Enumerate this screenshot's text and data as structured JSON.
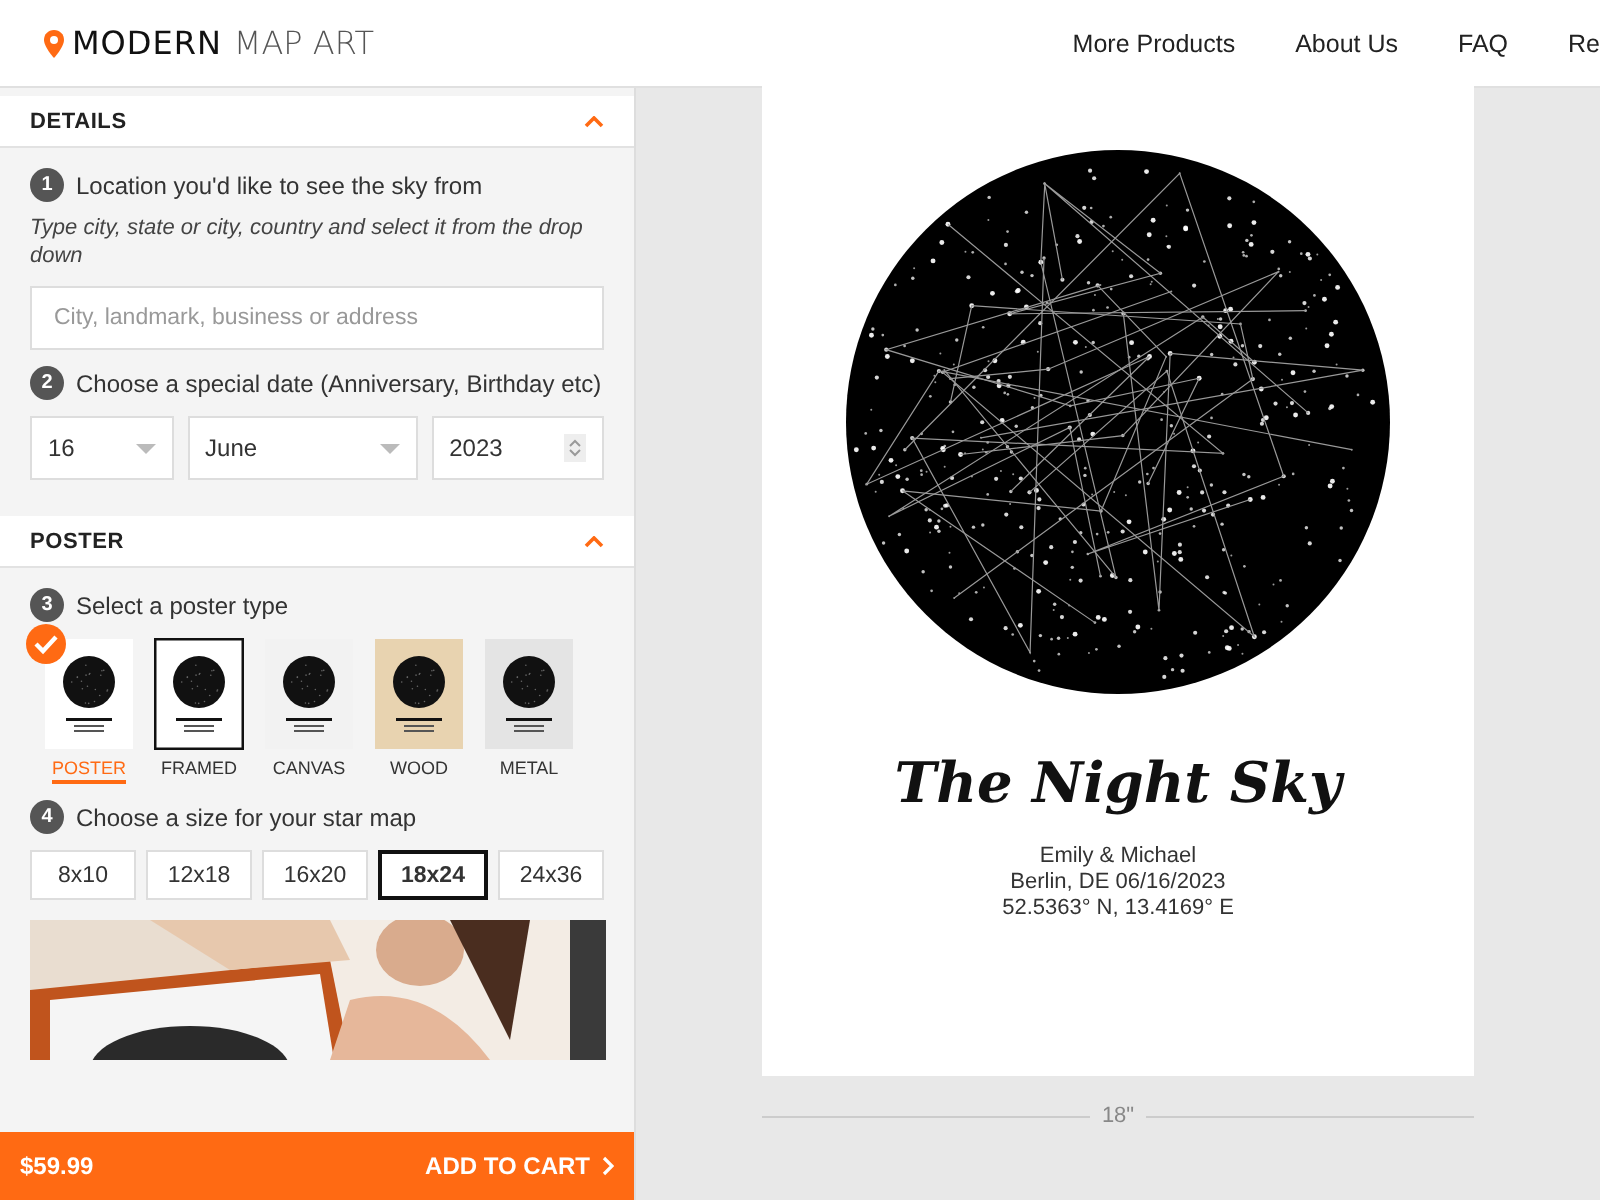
{
  "header": {
    "logo_bold": "MODERN",
    "logo_light": "MAP ART",
    "nav": [
      "More Products",
      "About Us",
      "FAQ",
      "Re"
    ]
  },
  "sections": [
    {
      "title": "DETAILS",
      "expanded": true,
      "steps": [
        {
          "kind": "location",
          "number": "1",
          "label": "Location you'd like to see the sky from",
          "hint": "Type city, state or city, country and select it from the drop down",
          "placeholder": "City, landmark, business or address"
        },
        {
          "kind": "date",
          "number": "2",
          "label": "Choose a special date (Anniversary, Birthday etc)",
          "day": "16",
          "month": "June",
          "year": "2023"
        }
      ]
    },
    {
      "title": "POSTER",
      "expanded": true,
      "steps": [
        {
          "kind": "types",
          "number": "3",
          "label": "Select a poster type",
          "options": [
            {
              "label": "POSTER",
              "selected": true,
              "kind": "plain"
            },
            {
              "label": "FRAMED",
              "selected": false,
              "kind": "frame"
            },
            {
              "label": "CANVAS",
              "selected": false,
              "kind": "canvas"
            },
            {
              "label": "WOOD",
              "selected": false,
              "kind": "wood"
            },
            {
              "label": "METAL",
              "selected": false,
              "kind": "metal"
            }
          ]
        },
        {
          "kind": "sizes",
          "number": "4",
          "label": "Choose a size for your star map",
          "options": [
            {
              "label": "8x10",
              "selected": false
            },
            {
              "label": "12x18",
              "selected": false
            },
            {
              "label": "16x20",
              "selected": false
            },
            {
              "label": "18x24",
              "selected": true
            },
            {
              "label": "24x36",
              "selected": false
            }
          ]
        }
      ]
    }
  ],
  "cart": {
    "price": "$59.99",
    "button": "ADD TO CART"
  },
  "preview": {
    "title": "The Night Sky",
    "lines": [
      "Emily & Michael",
      "Berlin, DE 06/16/2023",
      "52.5363° N, 13.4169° E"
    ],
    "width_label": "18\""
  }
}
